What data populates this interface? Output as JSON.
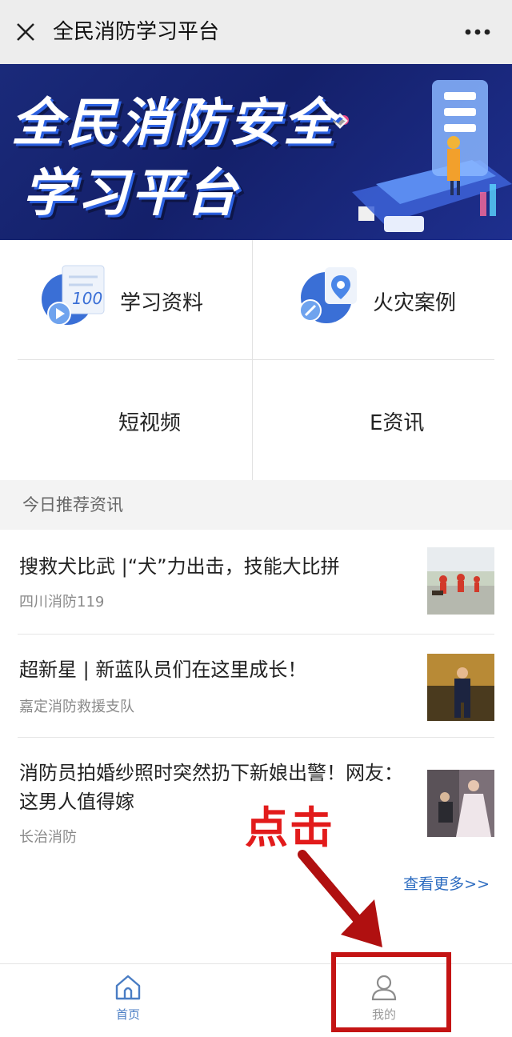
{
  "topbar": {
    "title": "全民消防学习平台",
    "close_icon": "close-icon",
    "more_icon": "more-icon"
  },
  "banner": {
    "line1": "全民消防安全",
    "line2": "学习平台"
  },
  "menu": {
    "items": [
      {
        "label": "学习资料",
        "icon": "study-materials-icon"
      },
      {
        "label": "火灾案例",
        "icon": "fire-cases-icon"
      },
      {
        "label": "短视频"
      },
      {
        "label": "E资讯"
      }
    ]
  },
  "section": {
    "title": "今日推荐资讯"
  },
  "news": [
    {
      "title": "搜救犬比武 |“犬”力出击，技能大比拼",
      "source": "四川消防119"
    },
    {
      "title": "超新星 | 新蓝队员们在这里成长！",
      "source": "嘉定消防救援支队"
    },
    {
      "title": "消防员拍婚纱照时突然扔下新娘出警！网友：这男人值得嫁",
      "source": "长治消防"
    }
  ],
  "more_link": "查看更多>>",
  "tabbar": {
    "items": [
      {
        "label": "首页",
        "icon": "home-icon",
        "active": true
      },
      {
        "label": "我的",
        "icon": "user-icon",
        "active": false
      }
    ]
  },
  "annotation": {
    "text": "点击"
  },
  "colors": {
    "accent": "#2d6cc0",
    "tab_active": "#4a7dc4",
    "tab_inactive": "#999999",
    "annotation_red": "#c41414"
  }
}
